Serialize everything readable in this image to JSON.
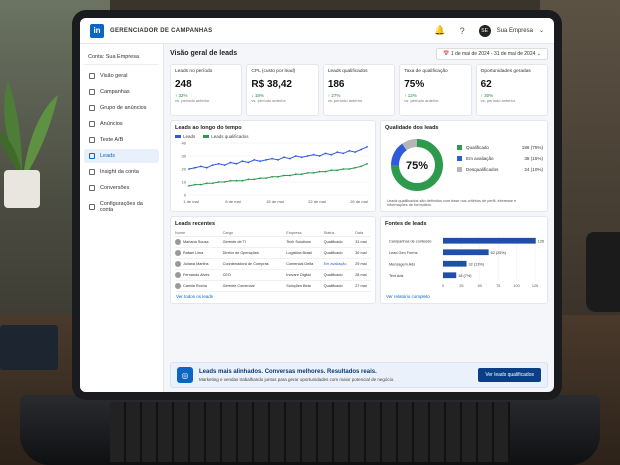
{
  "app": {
    "title": "GERENCIADOR DE CAMPANHAS",
    "company": "Sua Empresa",
    "avatar": "SE",
    "account": "Conta: Sua Empresa"
  },
  "nav": [
    "Visão geral",
    "Campanhas",
    "Grupo de anúncios",
    "Anúncios",
    "Teste A/B",
    "Leads",
    "Insight da conta",
    "Conversões",
    "Configurações da conta"
  ],
  "nav_active": 5,
  "page": {
    "title": "Visão geral de leads",
    "date": "1 de mai de 2024 - 31 de mai de 2024"
  },
  "kpis": [
    {
      "label": "Leads no período",
      "value": "248",
      "delta": "↑ 32%",
      "cmp": "vs. período anterior"
    },
    {
      "label": "CPL (custo por lead)",
      "value": "R$ 38,42",
      "delta": "↓ 18%",
      "cmp": "vs. período anterior"
    },
    {
      "label": "Leads qualificados",
      "value": "186",
      "delta": "↑ 27%",
      "cmp": "vs. período anterior"
    },
    {
      "label": "Taxa de qualificação",
      "value": "75%",
      "delta": "↑ 12%",
      "cmp": "vs. período anterior"
    },
    {
      "label": "Oportunidades geradas",
      "value": "62",
      "delta": "↑ 30%",
      "cmp": "vs. período anterior"
    }
  ],
  "chart_data": [
    {
      "type": "line",
      "title": "Leads ao longo do tempo",
      "x": [
        "1 de mai",
        "8 de mai",
        "15 de mai",
        "22 de mai",
        "29 de mai"
      ],
      "ylim": [
        0,
        40
      ],
      "yticks": [
        0,
        10,
        20,
        30,
        40
      ],
      "series": [
        {
          "name": "Leads",
          "color": "#2f5bd8",
          "values": [
            20,
            21,
            22,
            21,
            23,
            24,
            23,
            25,
            24,
            26,
            25,
            27,
            26,
            27,
            28,
            27,
            29,
            28,
            30,
            29,
            30,
            31,
            30,
            32,
            31,
            33,
            32,
            34,
            33,
            35,
            37
          ]
        },
        {
          "name": "Leads qualificados",
          "color": "#2e9a4e",
          "values": [
            7,
            8,
            8,
            9,
            9,
            10,
            10,
            11,
            11,
            11,
            12,
            12,
            13,
            13,
            14,
            14,
            15,
            15,
            16,
            16,
            17,
            17,
            18,
            18,
            19,
            19,
            20,
            20,
            21,
            22,
            24
          ]
        }
      ]
    },
    {
      "type": "pie",
      "title": "Qualidade dos leads",
      "center": "75%",
      "slices": [
        {
          "label": "Qualificado",
          "value": 186,
          "text": "186 (75%)",
          "color": "#2e9a4e"
        },
        {
          "label": "Em avaliação",
          "value": 38,
          "text": "38 (15%)",
          "color": "#2f5bd8"
        },
        {
          "label": "Desqualificados",
          "value": 24,
          "text": "24 (10%)",
          "color": "#b5b5b5"
        }
      ],
      "note": "Leads qualificados são definidos com base nos critérios de perfil, interesse e informações de formulário."
    },
    {
      "type": "bar",
      "title": "Fontes de leads",
      "categories": [
        "Campanhas de conteúdo",
        "Lead Gen Forms",
        "Mensagem Ads",
        "Text Ads"
      ],
      "values": [
        126,
        62,
        32,
        18
      ],
      "labels": [
        "126 (51%)",
        "62 (25%)",
        "32 (13%)",
        "18 (7%)"
      ],
      "xticks": [
        0,
        25,
        50,
        75,
        100,
        125
      ],
      "xlim": [
        0,
        125
      ],
      "color": "#1f4fa8"
    }
  ],
  "leads": {
    "title": "Leads recentes",
    "headers": [
      "Nome",
      "Cargo",
      "Empresa",
      "Status",
      "Data"
    ],
    "rows": [
      [
        "Mariana Souza",
        "Gerente de TI",
        "Tech Solutions",
        "Qualificado",
        "31 mai"
      ],
      [
        "Rafael Lima",
        "Diretor de Operações",
        "Logística Brasil",
        "Qualificado",
        "30 mai"
      ],
      [
        "Juliana Martins",
        "Coordenadora de Compras",
        "Comercial Delta",
        "Em avaliação",
        "29 mai"
      ],
      [
        "Fernando Alves",
        "CEO",
        "Inovare Digital",
        "Qualificado",
        "28 mai"
      ],
      [
        "Camila Rocha",
        "Gerente Comercial",
        "Soluções Beta",
        "Qualificado",
        "27 mai"
      ]
    ],
    "link": "Ver todos os leads"
  },
  "sources_link": "Ver relatório completo",
  "banner": {
    "title": "Leads mais alinhados. Conversas melhores. Resultados reais.",
    "desc": "Marketing e vendas trabalhando juntos para gerar oportunidades com maior potencial de negócio.",
    "button": "Ver leads qualificados"
  }
}
